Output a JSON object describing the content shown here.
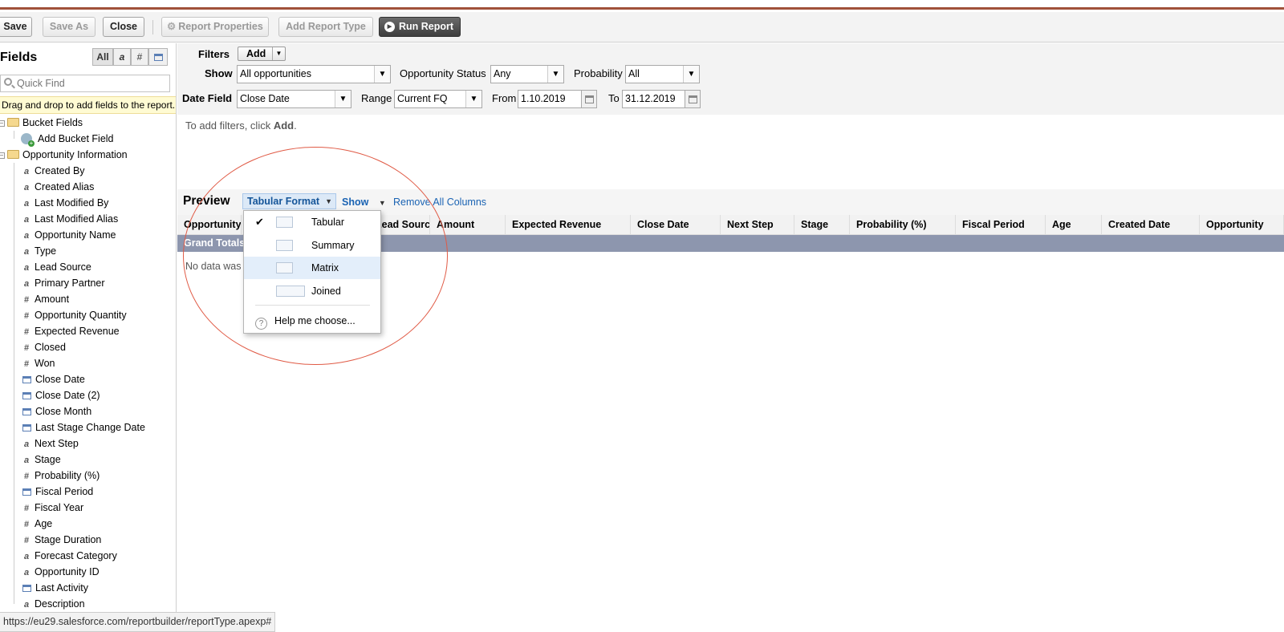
{
  "toolbar": {
    "save": "Save",
    "save_as": "Save As",
    "close": "Close",
    "report_properties": "Report Properties",
    "add_report_type": "Add Report Type",
    "run_report": "Run Report"
  },
  "fields_panel": {
    "title": "Fields",
    "type_filters": [
      "All",
      "a",
      "#",
      "cal"
    ],
    "quick_find_placeholder": "Quick Find",
    "hint": "Drag and drop to add fields to the report.",
    "groups": [
      {
        "label": "Bucket Fields",
        "items": [
          {
            "label": "Add Bucket Field",
            "type": "bucket"
          }
        ]
      },
      {
        "label": "Opportunity Information",
        "items": [
          {
            "label": "Created By",
            "type": "text"
          },
          {
            "label": "Created Alias",
            "type": "text"
          },
          {
            "label": "Last Modified By",
            "type": "text"
          },
          {
            "label": "Last Modified Alias",
            "type": "text"
          },
          {
            "label": "Opportunity Name",
            "type": "text"
          },
          {
            "label": "Type",
            "type": "text"
          },
          {
            "label": "Lead Source",
            "type": "text"
          },
          {
            "label": "Primary Partner",
            "type": "text"
          },
          {
            "label": "Amount",
            "type": "number"
          },
          {
            "label": "Opportunity Quantity",
            "type": "number"
          },
          {
            "label": "Expected Revenue",
            "type": "number"
          },
          {
            "label": "Closed",
            "type": "number"
          },
          {
            "label": "Won",
            "type": "number"
          },
          {
            "label": "Close Date",
            "type": "date"
          },
          {
            "label": "Close Date (2)",
            "type": "date"
          },
          {
            "label": "Close Month",
            "type": "date"
          },
          {
            "label": "Last Stage Change Date",
            "type": "date"
          },
          {
            "label": "Next Step",
            "type": "text"
          },
          {
            "label": "Stage",
            "type": "text"
          },
          {
            "label": "Probability (%)",
            "type": "number"
          },
          {
            "label": "Fiscal Period",
            "type": "date"
          },
          {
            "label": "Fiscal Year",
            "type": "number"
          },
          {
            "label": "Age",
            "type": "number"
          },
          {
            "label": "Stage Duration",
            "type": "number"
          },
          {
            "label": "Forecast Category",
            "type": "text"
          },
          {
            "label": "Opportunity ID",
            "type": "text"
          },
          {
            "label": "Last Activity",
            "type": "date"
          },
          {
            "label": "Description",
            "type": "text"
          }
        ]
      }
    ]
  },
  "filters": {
    "label": "Filters",
    "add_button": "Add",
    "show_label": "Show",
    "show_value": "All opportunities",
    "status_label": "Opportunity Status",
    "status_value": "Any",
    "probability_label": "Probability",
    "probability_value": "All",
    "date_field_label": "Date Field",
    "date_field_value": "Close Date",
    "range_label": "Range",
    "range_value": "Current FQ",
    "from_label": "From",
    "from_value": "1.10.2019",
    "to_label": "To",
    "to_value": "31.12.2019",
    "add_msg_prefix": "To add filters, click ",
    "add_msg_bold": "Add",
    "add_msg_suffix": "."
  },
  "preview": {
    "title": "Preview",
    "format_button": "Tabular Format",
    "show_link": "Show",
    "remove_link": "Remove All Columns",
    "columns": [
      "Opportunity N",
      "Lead Source",
      "Amount",
      "Expected Revenue",
      "Close Date",
      "Next Step",
      "Stage",
      "Probability (%)",
      "Fiscal Period",
      "Age",
      "Created Date",
      "Opportunity"
    ],
    "grand_totals": "Grand Totals",
    "no_data": "No data was"
  },
  "format_menu": {
    "items": [
      {
        "label": "Tabular",
        "checked": true,
        "highlighted": false
      },
      {
        "label": "Summary",
        "checked": false,
        "highlighted": false
      },
      {
        "label": "Matrix",
        "checked": false,
        "highlighted": true
      },
      {
        "label": "Joined",
        "checked": false,
        "highlighted": false
      }
    ],
    "help": "Help me choose..."
  },
  "statusbar": {
    "url": "https://eu29.salesforce.com/reportbuilder/reportType.apexp#"
  },
  "colors": {
    "accent_bar": "#a0513a",
    "annotation_ellipse": "#e05a45",
    "grand_totals_bg": "#8d96ae"
  }
}
